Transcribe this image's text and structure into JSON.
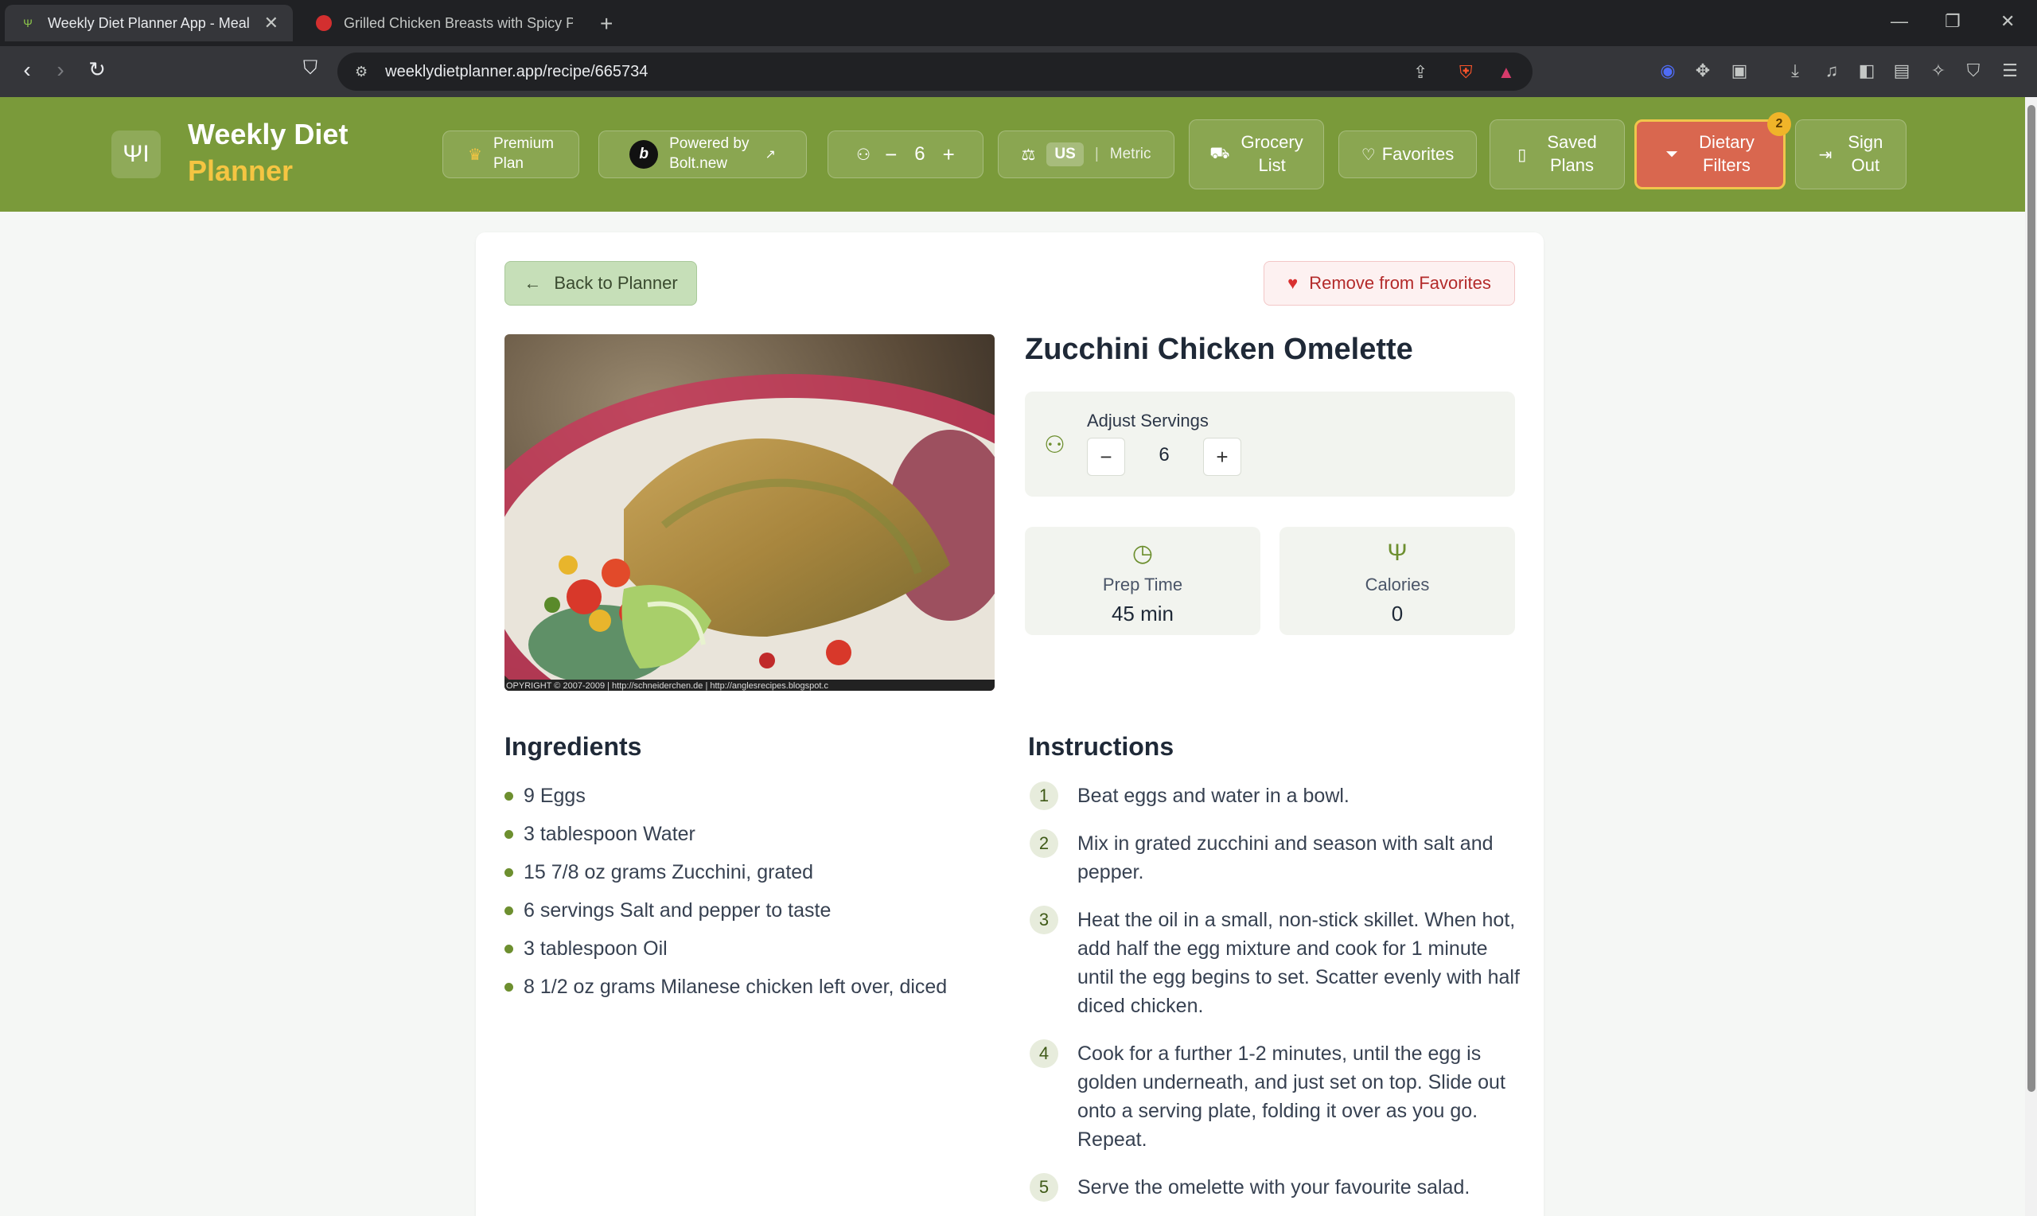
{
  "browser": {
    "tabs": [
      {
        "title": "Weekly Diet Planner App - Meal"
      },
      {
        "title": "Grilled Chicken Breasts with Spicy Pe"
      }
    ],
    "url": "weeklydietplanner.app/recipe/665734"
  },
  "header": {
    "brand_line1": "Weekly Diet",
    "brand_line2": "Planner",
    "premium_line1": "Premium",
    "premium_line2": "Plan",
    "powered_line1": "Powered by",
    "powered_line2": "Bolt.new",
    "servings_value": "6",
    "unit_us": "US",
    "unit_metric": "Metric",
    "grocery_line1": "Grocery",
    "grocery_line2": "List",
    "favorites": "Favorites",
    "saved_line1": "Saved",
    "saved_line2": "Plans",
    "dietary_line1": "Dietary",
    "dietary_line2": "Filters",
    "dietary_badge": "2",
    "signout_line1": "Sign",
    "signout_line2": "Out"
  },
  "recipe": {
    "back_label": "Back to Planner",
    "remove_label": "Remove from Favorites",
    "title": "Zucchini Chicken Omelette",
    "adjust_label": "Adjust Servings",
    "servings": "6",
    "prep_label": "Prep Time",
    "prep_value": "45 min",
    "calories_label": "Calories",
    "calories_value": "0",
    "photo_caption": "OPYRIGHT © 2007-2009 | http://schneiderchen.de | http://anglesrecipes.blogspot.c",
    "ingredients_heading": "Ingredients",
    "ingredients": [
      "9 Eggs",
      "3 tablespoon Water",
      "15 7/8 oz grams Zucchini, grated",
      "6 servings Salt and pepper to taste",
      "3 tablespoon Oil",
      "8 1/2 oz grams Milanese chicken left over, diced"
    ],
    "instructions_heading": "Instructions",
    "instructions": [
      {
        "n": "1",
        "text": "Beat eggs and water in a bowl."
      },
      {
        "n": "2",
        "text": "Mix in grated zucchini and season with salt and pepper."
      },
      {
        "n": "3",
        "text": "Heat the oil in a small, non-stick skillet. When hot, add half the egg mixture and cook for 1 minute until the egg begins to set. Scatter evenly with half diced chicken."
      },
      {
        "n": "4",
        "text": "Cook for a further 1-2 minutes, until the egg is golden underneath, and just set on top. Slide out onto a serving plate, folding it over as you go. Repeat."
      },
      {
        "n": "5",
        "text": "Serve the omelette with your favourite salad."
      }
    ]
  },
  "colors": {
    "header_green": "#7a9a3a",
    "accent_yellow": "#f5c542",
    "dietary_red": "#d9674f"
  }
}
